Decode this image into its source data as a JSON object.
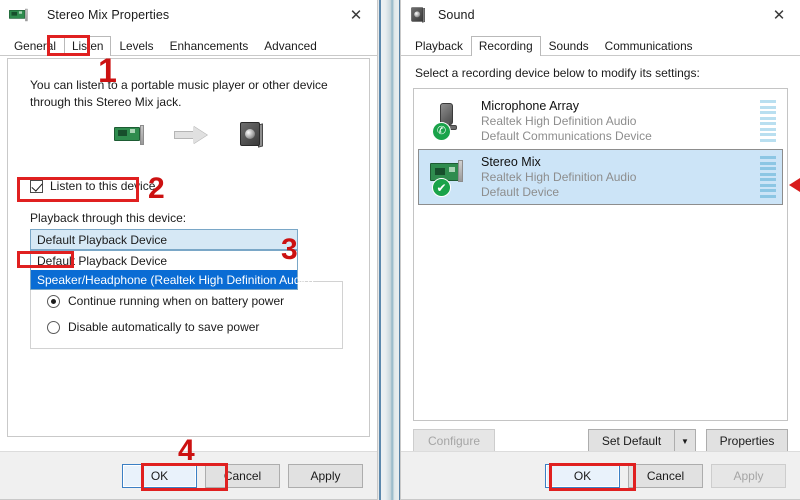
{
  "properties_dialog": {
    "title": "Stereo Mix Properties",
    "icon": "sound-card-icon",
    "close_label": "✕",
    "tabs": [
      {
        "label": "General",
        "active": false
      },
      {
        "label": "Listen",
        "active": true
      },
      {
        "label": "Levels",
        "active": false
      },
      {
        "label": "Enhancements",
        "active": false
      },
      {
        "label": "Advanced",
        "active": false
      }
    ],
    "description": "You can listen to a portable music player or other device through this Stereo Mix jack.",
    "device_flow": {
      "source_icon": "sound-card-icon",
      "arrow_icon": "right-arrow-icon",
      "target_icon": "speaker-icon"
    },
    "listen_checkbox": {
      "label": "Listen to this device",
      "checked": true
    },
    "playback_label": "Playback through this device:",
    "combo_value": "Default Playback Device",
    "combo_caret": "⌄",
    "dropdown_options": [
      {
        "label": "Default Playback Device",
        "selected": false
      },
      {
        "label": "Speaker/Headphone (Realtek High Definition Audio)",
        "selected": true
      }
    ],
    "power_options": [
      {
        "label": "Continue running when on battery power",
        "selected": true
      },
      {
        "label": "Disable automatically to save power",
        "selected": false
      }
    ],
    "buttons": {
      "ok": "OK",
      "cancel": "Cancel",
      "apply": "Apply"
    }
  },
  "sound_dialog": {
    "title": "Sound",
    "icon": "speaker-icon",
    "close_label": "✕",
    "tabs": [
      {
        "label": "Playback",
        "active": false
      },
      {
        "label": "Recording",
        "active": true
      },
      {
        "label": "Sounds",
        "active": false
      },
      {
        "label": "Communications",
        "active": false
      }
    ],
    "hint": "Select a recording device below to modify its settings:",
    "devices": [
      {
        "name": "Microphone Array",
        "driver": "Realtek High Definition Audio",
        "status": "Default Communications Device",
        "icon": "microphone-icon",
        "badge": "phone-badge-icon",
        "badge_glyph": "✆",
        "selected": false
      },
      {
        "name": "Stereo Mix",
        "driver": "Realtek High Definition Audio",
        "status": "Default Device",
        "icon": "sound-card-icon",
        "badge": "check-badge-icon",
        "badge_glyph": "✔",
        "selected": true
      }
    ],
    "actions": {
      "configure": "Configure",
      "configure_disabled": true,
      "set_default": "Set Default",
      "set_default_caret": "▼",
      "properties": "Properties"
    },
    "buttons": {
      "ok": "OK",
      "cancel": "Cancel",
      "apply": "Apply",
      "apply_disabled": true
    }
  },
  "annotations": {
    "step1": "1",
    "step2": "2",
    "step3": "3",
    "step4": "4"
  },
  "colors": {
    "annotation_red": "#e02020",
    "selection_blue": "#0a6cd4",
    "list_selection": "#cce4f7",
    "badge_green": "#1aa34a"
  }
}
